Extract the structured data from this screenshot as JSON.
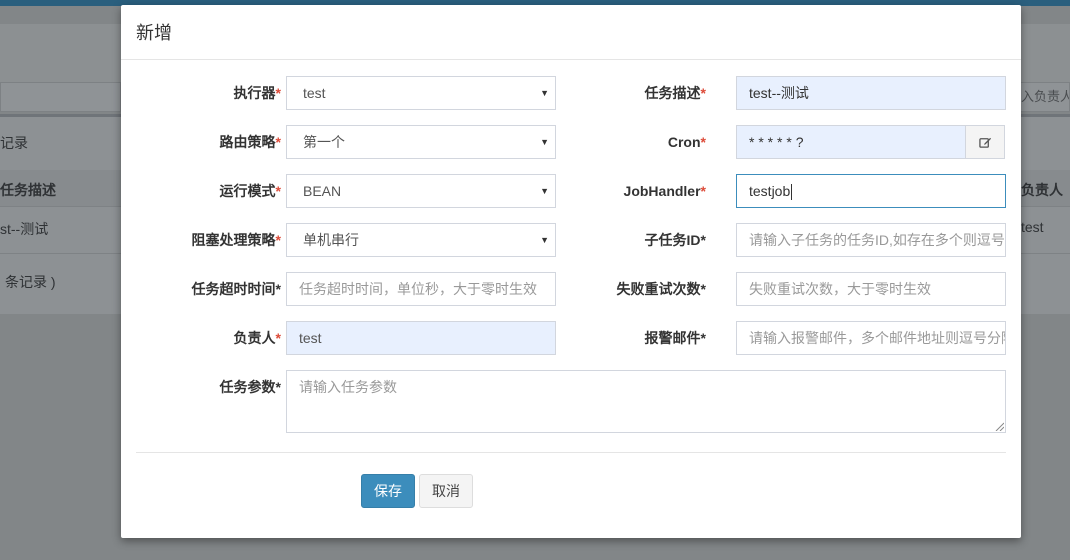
{
  "background": {
    "search_placeholder_fragment": "入负责人",
    "section_title_fragment": "记录",
    "col_desc_fragment": "任务描述",
    "col_owner_fragment": "负责人",
    "row_desc_fragment": "st--测试",
    "row_owner": "test",
    "footer_fragment": "条记录 )"
  },
  "modal": {
    "title": "新增",
    "required_mark": "*",
    "fields": {
      "executor": {
        "label": "执行器",
        "value": "test"
      },
      "route": {
        "label": "路由策略",
        "value": "第一个"
      },
      "run_mode": {
        "label": "运行模式",
        "value": "BEAN"
      },
      "block_strategy": {
        "label": "阻塞处理策略",
        "value": "单机串行"
      },
      "timeout": {
        "label": "任务超时时间*",
        "placeholder": "任务超时时间，单位秒，大于零时生效"
      },
      "owner": {
        "label": "负责人",
        "value": "test"
      },
      "params": {
        "label": "任务参数*",
        "placeholder": "请输入任务参数"
      },
      "desc": {
        "label": "任务描述",
        "value": "test--测试"
      },
      "cron": {
        "label": "Cron",
        "value": "* * * * * ?"
      },
      "handler": {
        "label": "JobHandler",
        "value": "testjob"
      },
      "child_ids": {
        "label": "子任务ID*",
        "placeholder": "请输入子任务的任务ID,如存在多个则逗号分隔"
      },
      "retry": {
        "label": "失败重试次数*",
        "placeholder": "失败重试次数，大于零时生效"
      },
      "alarm_email": {
        "label": "报警邮件*",
        "placeholder": "请输入报警邮件，多个邮件地址则逗号分隔"
      }
    },
    "buttons": {
      "save": "保存",
      "cancel": "取消"
    },
    "icons": {
      "select_caret": "caret-down-icon",
      "cron_edit": "edit-icon"
    }
  }
}
